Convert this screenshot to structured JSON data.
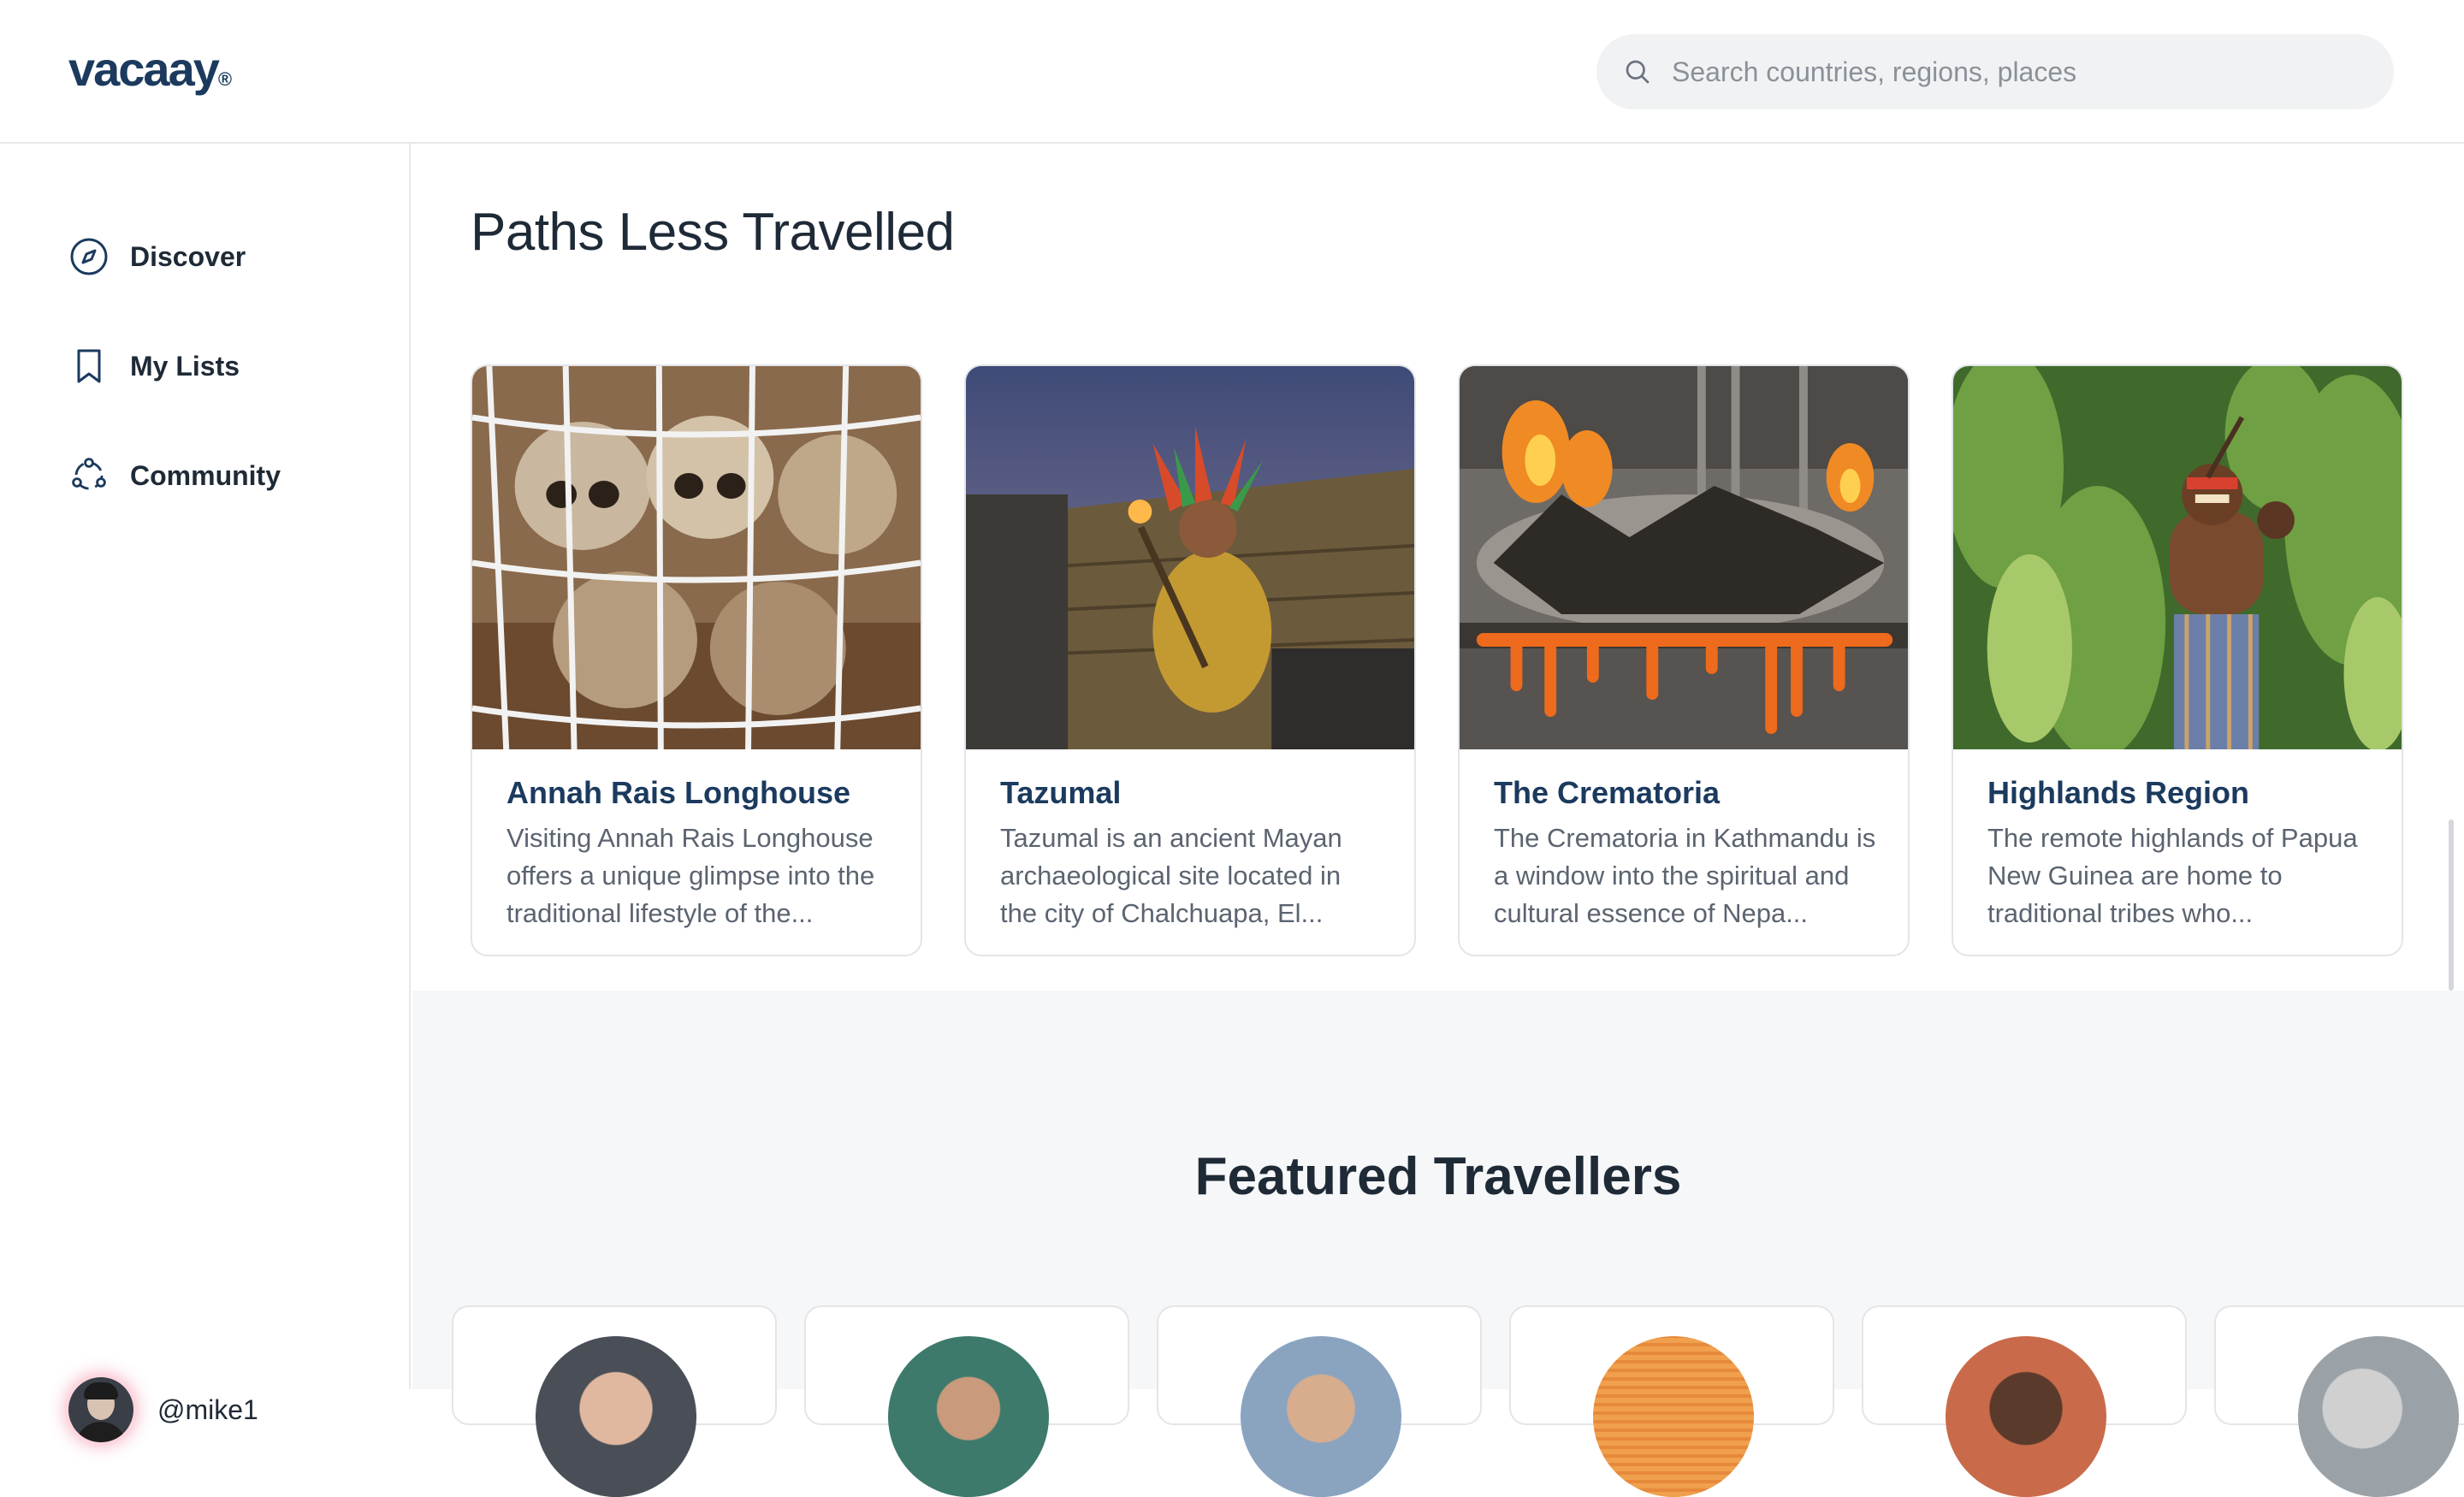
{
  "app": {
    "logo": "vacaay",
    "logo_mark": "®"
  },
  "search": {
    "placeholder": "Search countries, regions, places"
  },
  "sidebar": {
    "items": [
      {
        "label": "Discover",
        "icon": "compass-icon"
      },
      {
        "label": "My Lists",
        "icon": "bookmark-icon"
      },
      {
        "label": "Community",
        "icon": "community-icon"
      }
    ],
    "user": {
      "handle": "@mike1"
    }
  },
  "paths": {
    "title": "Paths Less Travelled",
    "cards": [
      {
        "title": "Annah Rais Longhouse",
        "description": "Visiting Annah Rais Longhouse offers a unique glimpse into the traditional lifestyle of the...",
        "image": "skulls-in-wire-basket"
      },
      {
        "title": "Tazumal",
        "description": "Tazumal is an ancient Mayan archaeological site located in the city of Chalchuapa, El...",
        "image": "mayan-ceremony-performer"
      },
      {
        "title": "The Crematoria",
        "description": "The Crematoria in Kathmandu is a window into the spiritual and cultural essence of Nepa...",
        "image": "burning-pyre-marigolds"
      },
      {
        "title": "Highlands Region",
        "description": "The remote highlands of Papua New Guinea are home to traditional tribes who...",
        "image": "tribesman-in-forest"
      }
    ]
  },
  "featured": {
    "title": "Featured Travellers",
    "count_visible": 6
  },
  "colors": {
    "brand": "#1b3a5e",
    "text": "#1f2a37",
    "muted": "#5b6470",
    "section_bg": "#f6f7f8"
  }
}
